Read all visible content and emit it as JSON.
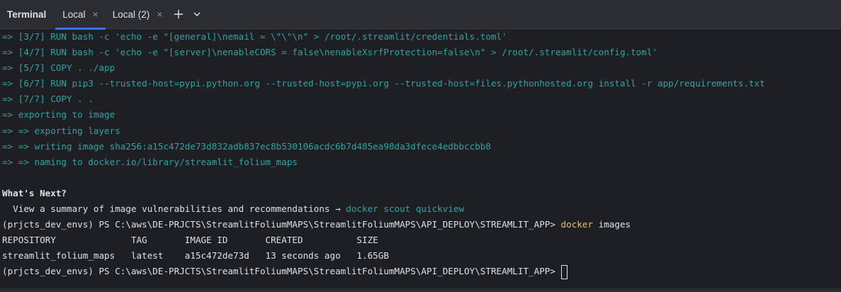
{
  "tabbar": {
    "title": "Terminal",
    "tabs": [
      {
        "label": "Local",
        "close": "×"
      },
      {
        "label": "Local (2)",
        "close": "×"
      }
    ],
    "new_tab": "+",
    "dropdown": "chevron-down"
  },
  "colors": {
    "teal": "#2fa3a7",
    "yellow": "#e5c07b",
    "accent": "#3574f0"
  },
  "lines": {
    "l1": "=> [3/7] RUN bash -c 'echo -e \"[general]\\nemail = \\\"\\\"\\n\" > /root/.streamlit/credentials.toml'",
    "l2": "=> [4/7] RUN bash -c 'echo -e \"[server]\\nenableCORS = false\\nenableXsrfProtection=false\\n\" > /root/.streamlit/config.toml'",
    "l3": "=> [5/7] COPY . ./app",
    "l4": "=> [6/7] RUN pip3 --trusted-host=pypi.python.org --trusted-host=pypi.org --trusted-host=files.pythonhosted.org install -r app/requirements.txt",
    "l5": "=> [7/7] COPY . .",
    "l6": "=> exporting to image",
    "l7": "=> => exporting layers",
    "l8": "=> => writing image sha256:a15c472de73d832adb837ec8b530106acdc6b7d485ea98da3dfece4edbbccbb8",
    "l9": "=> => naming to docker.io/library/streamlit_folium_maps",
    "whats_next": "What's Next?",
    "hint_text": "  View a summary of image vulnerabilities and recommendations → ",
    "hint_cmd": "docker scout quickview",
    "prompt": "(prjcts_dev_envs) PS C:\\aws\\DE-PRJCTS\\StreamlitFoliumMAPS\\StreamlitFoliumMAPS\\API_DEPLOY\\STREAMLIT_APP> ",
    "cmd_docker": "docker",
    "cmd_args": " images",
    "table_header": "REPOSITORY              TAG       IMAGE ID       CREATED          SIZE",
    "table_row": "streamlit_folium_maps   latest    a15c472de73d   13 seconds ago   1.65GB",
    "prompt2": "(prjcts_dev_envs) PS C:\\aws\\DE-PRJCTS\\StreamlitFoliumMAPS\\StreamlitFoliumMAPS\\API_DEPLOY\\STREAMLIT_APP> "
  }
}
